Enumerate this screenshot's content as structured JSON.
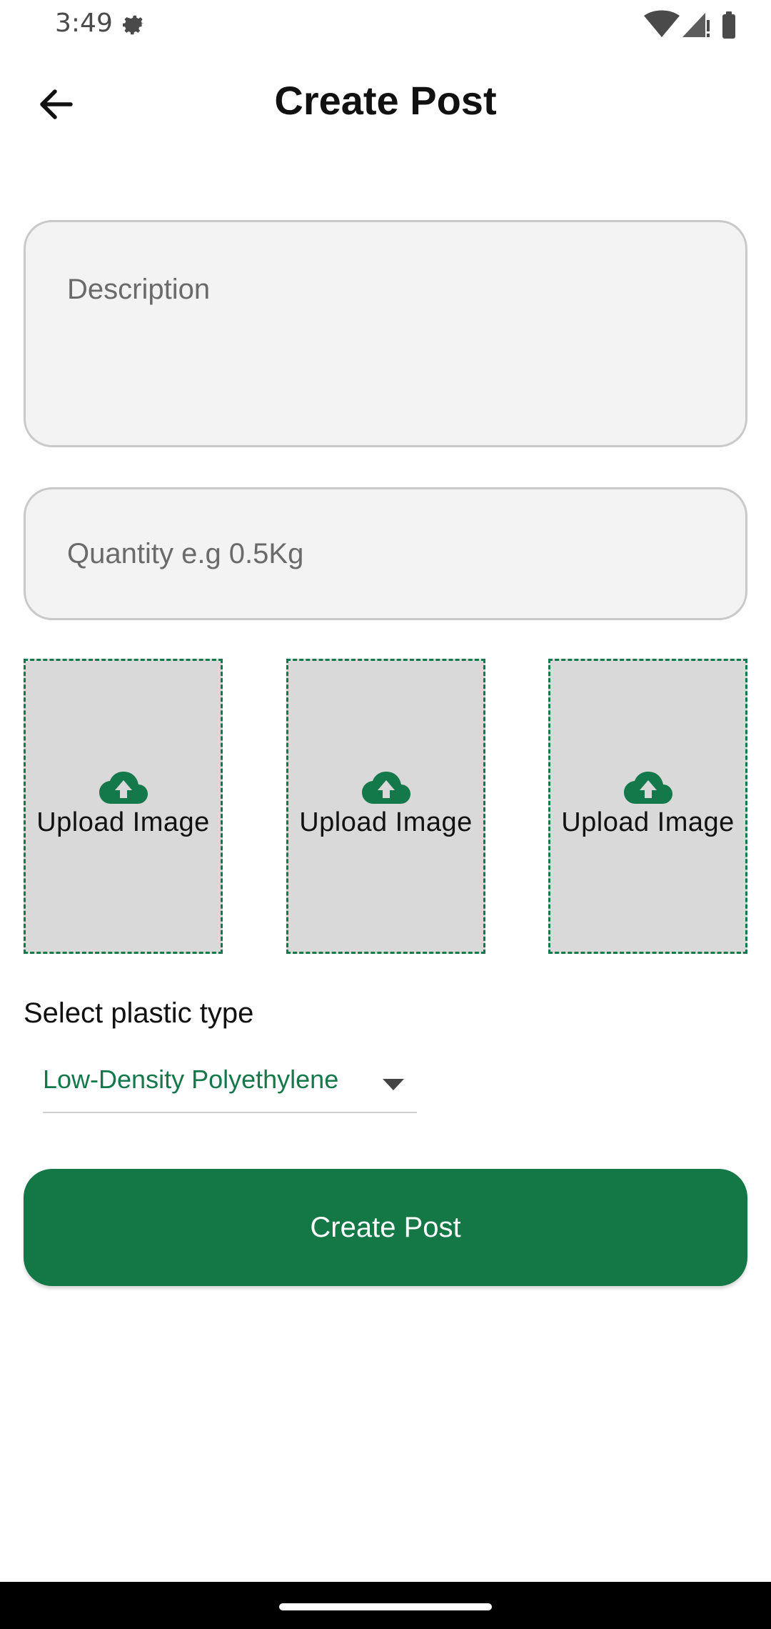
{
  "status_bar": {
    "time": "3:49",
    "icons": [
      "settings-gear-icon",
      "wifi-icon",
      "signal-icon",
      "battery-icon"
    ]
  },
  "app_bar": {
    "title": "Create Post",
    "back_icon": "arrow-left-icon"
  },
  "form": {
    "description_placeholder": "Description",
    "quantity_placeholder": "Quantity e.g 0.5Kg",
    "upload_slots": [
      {
        "label": "Upload Image",
        "icon": "cloud-upload-icon"
      },
      {
        "label": "Upload Image",
        "icon": "cloud-upload-icon"
      },
      {
        "label": "Upload Image",
        "icon": "cloud-upload-icon"
      }
    ],
    "plastic_type_label": "Select plastic type",
    "plastic_type_selected": "Low-Density Polyethylene",
    "submit_label": "Create Post"
  },
  "colors": {
    "primary_green": "#137746",
    "field_background": "#f3f3f3",
    "upload_background": "#d9d9d9"
  }
}
